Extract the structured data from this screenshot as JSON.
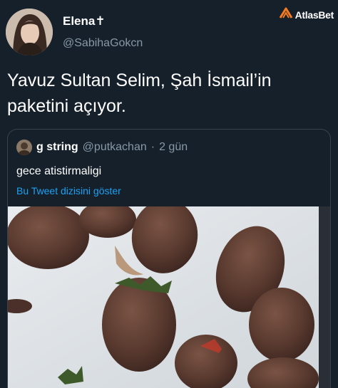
{
  "author": {
    "name": "Elena✝",
    "handle": "@SabihaGokcn"
  },
  "watermark": {
    "text": "AtlasBet",
    "icon": "atlasbet-logo-icon",
    "accent": "#f47b20"
  },
  "tweet": {
    "text": "Yavuz Sultan Selim, Şah İsmail’in paketini açıyor."
  },
  "quoted_tweet": {
    "name": "g string",
    "handle": "@putkachan",
    "separator": "·",
    "time": "2 gün",
    "text": "gece atistirmaligi",
    "thread_link": "Bu Tweet dizisini göster",
    "image_alt": "chocolate-covered strawberries on parchment paper"
  },
  "colors": {
    "background": "#15202b",
    "secondary_text": "#8899a6",
    "link": "#1da1f2",
    "border": "#38444d"
  }
}
